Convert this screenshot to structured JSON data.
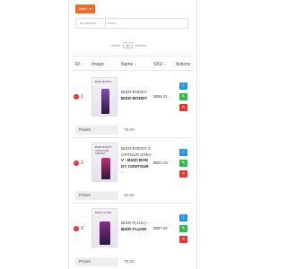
{
  "toolbar": {
    "filters_label": "filters"
  },
  "search": {
    "select_label": "All columns",
    "placeholder": "Search"
  },
  "pagination": {
    "show_label": "Show",
    "page_size": "10",
    "entries_label": "entries"
  },
  "table": {
    "headers": {
      "id": "ID",
      "image": "Image",
      "name": "Name",
      "sku": "SKU",
      "actions": "Actions"
    },
    "sort_glyph": "⇅",
    "rows": [
      {
        "index": "1",
        "thumb_brand": "BIZZI BODDY",
        "name_line1": "BIZZI BODDY -",
        "name_line2": "BIZZI BODDY",
        "sku": "BBB-01",
        "price_label": "Prices",
        "price": "79.00",
        "bottle_color": "#7d4fb5"
      },
      {
        "index": "2",
        "thumb_brand": "BIZZI BODDY CONTOUR CREAM",
        "name_line1": "BIZZI BODDY C",
        "name_line2": "ONTOUR CREA",
        "name_line3": "V - BIZZI BOD",
        "name_line4": "DY CONTOUR",
        "name_line5": "...",
        "sku": "BBC-02",
        "price_label": "Prices",
        "price": "42.00",
        "bottle_color": "#c72e6e"
      },
      {
        "index": "3",
        "thumb_brand": "BIZZI FLUSH",
        "name_line1": "BIZZI FLUSH -",
        "name_line2": "BIZZI FLUSH",
        "sku": "BBF-03",
        "price_label": "Prices",
        "price": "75.00",
        "bottle_color": "#8a2f86"
      }
    ]
  },
  "icons": {
    "row_minus": "−",
    "info": "ⓘ",
    "edit": "✎",
    "delete": "✕",
    "caret": "▾"
  },
  "colors": {
    "accent": "#f36a2b",
    "info": "#1e90e8",
    "edit": "#2fb84a",
    "delete": "#e3342f"
  }
}
